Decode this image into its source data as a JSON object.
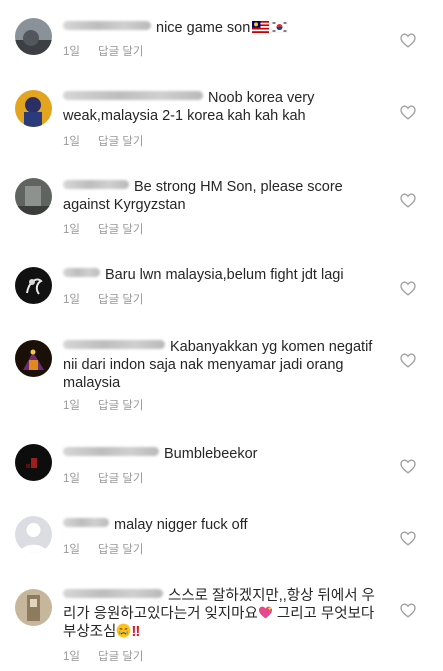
{
  "comments": [
    {
      "text": "nice game son",
      "time": "1일",
      "reply": "답글 달기"
    },
    {
      "text": "Noob korea very weak,malaysia 2-1 korea kah kah kah",
      "time": "1일",
      "reply": "답글 달기"
    },
    {
      "text": "Be strong HM Son, please score against Kyrgyzstan",
      "time": "1일",
      "reply": "답글 달기"
    },
    {
      "text": "Baru lwn malaysia,belum fight jdt lagi",
      "time": "1일",
      "reply": "답글 달기"
    },
    {
      "text": "Kabanyakkan yg komen negatif nii dari indon saja nak menyamar jadi orang malaysia",
      "time": "1일",
      "reply": "답글 달기"
    },
    {
      "text": "Bumblebeekor",
      "time": "1일",
      "reply": "답글 달기"
    },
    {
      "text": "malay nigger fuck off",
      "time": "1일",
      "reply": "답글 달기"
    },
    {
      "text": "스스로 잘하겠지만,,항상 뒤에서 우리가 응원하고있다는거 잊지마요",
      "text2": "그리고 무엇보다 부상조심",
      "bangs": "!!",
      "time": "1일",
      "reply": "답글 달기"
    }
  ],
  "icons": {
    "like": "heart-outline-icon",
    "flag_1": "malaysia-flag-icon",
    "flag_2": "korea-flag-icon",
    "emoji_1": "sparkling-heart-icon",
    "emoji_2": "crying-face-icon"
  },
  "colors": {
    "text": "#262626",
    "meta": "#999999",
    "heart": "#a0a0a0"
  }
}
